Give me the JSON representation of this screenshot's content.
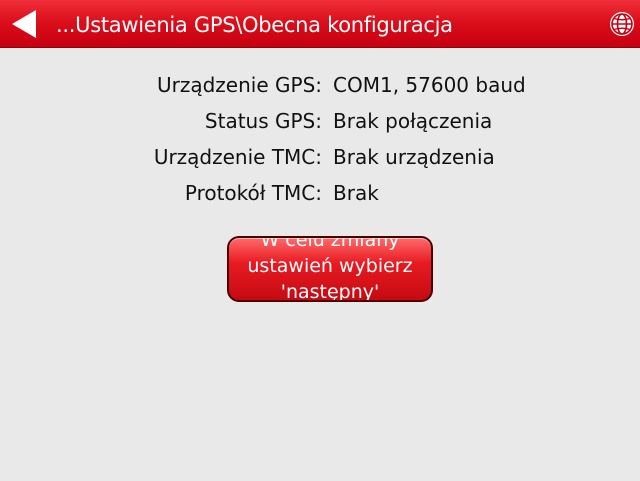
{
  "header": {
    "title": "...Ustawienia GPS\\Obecna konfiguracja",
    "back_icon": "back-arrow-icon",
    "globe_icon": "globe-icon"
  },
  "info_rows": [
    {
      "label": "Urządzenie GPS:",
      "value": "COM1, 57600 baud"
    },
    {
      "label": "Status GPS:",
      "value": "Brak połączenia"
    },
    {
      "label": "Urządzenie TMC:",
      "value": "Brak urządzenia"
    },
    {
      "label": "Protokół TMC:",
      "value": "Brak"
    }
  ],
  "action_button": {
    "label": "W celu zmiany\nustawień wybierz\n'następny'"
  },
  "colors": {
    "titlebar": "#dc0f1c",
    "background": "#e9e9e9",
    "button": "#e81b22"
  }
}
